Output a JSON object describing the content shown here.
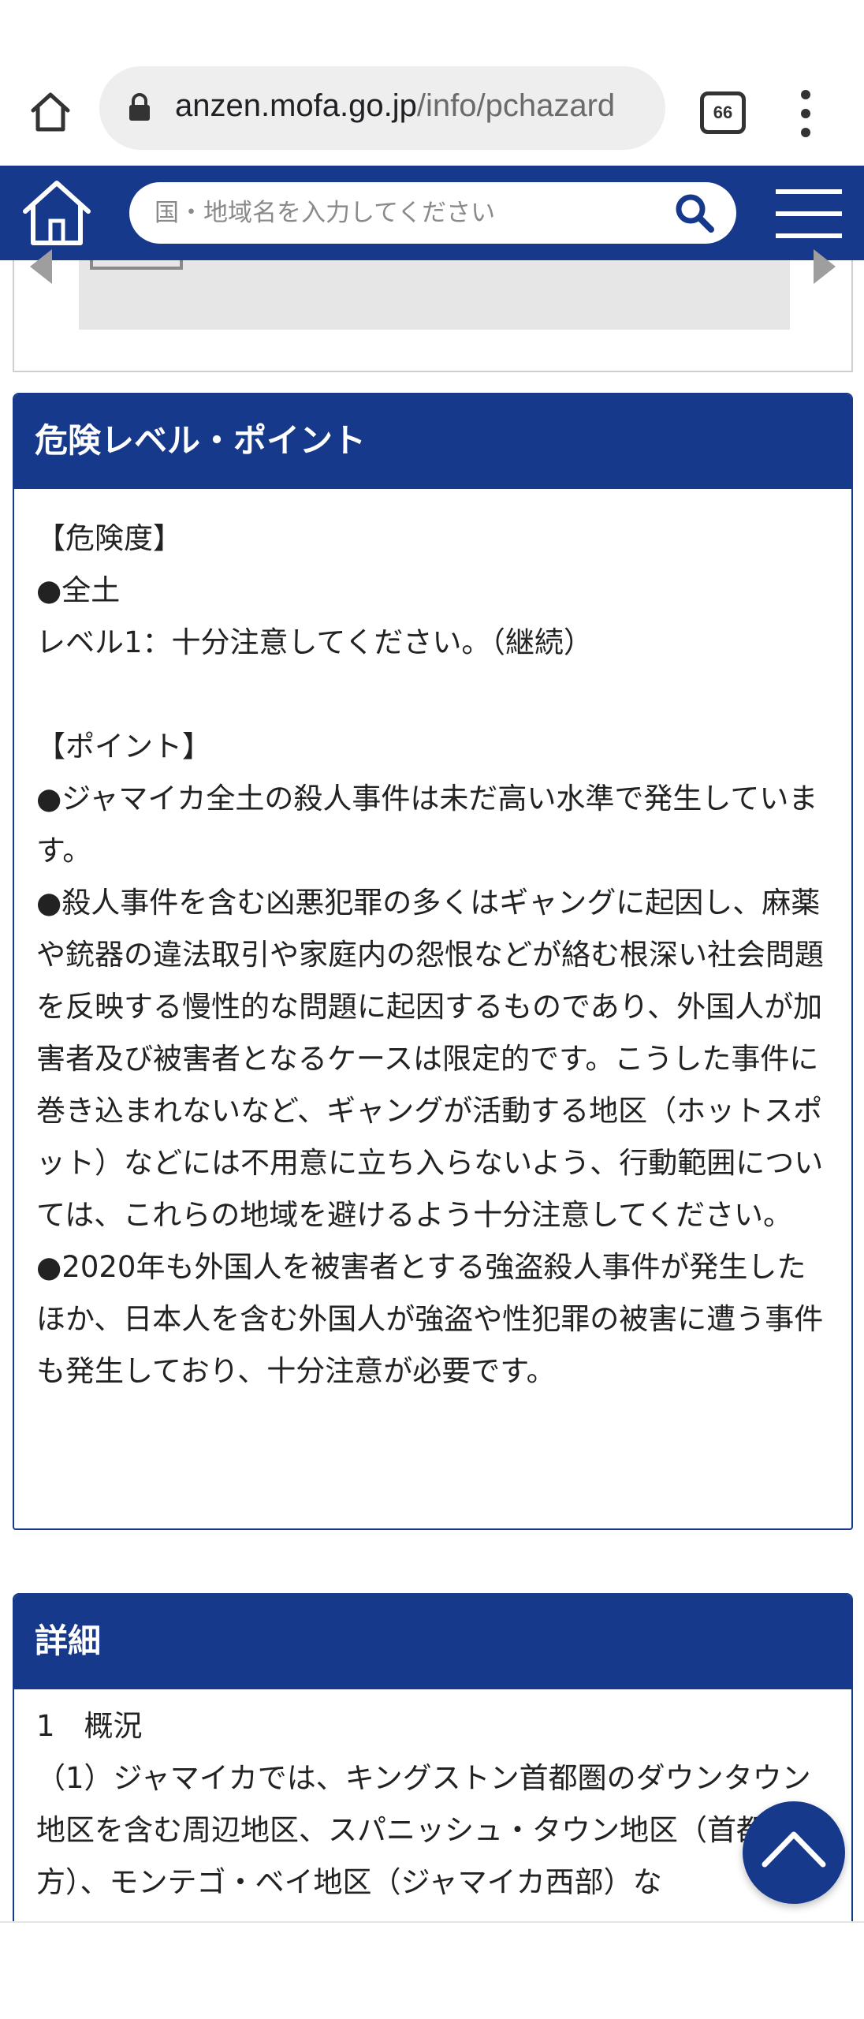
{
  "browser": {
    "url_host": "anzen.mofa.go.jp",
    "url_path": "/info/pchazard",
    "tab_count": "66"
  },
  "site": {
    "search_placeholder": "国・地域名を入力してください"
  },
  "risk_section": {
    "title": "危険レベル・ポイント",
    "paragraphs": [
      "【危険度】",
      "●全土",
      "レベル1：十分注意してください。（継続）",
      "",
      "【ポイント】",
      "●ジャマイカ全土の殺人事件は未だ高い水準で発生しています。",
      "●殺人事件を含む凶悪犯罪の多くはギャングに起因し、麻薬や銃器の違法取引や家庭内の怨恨などが絡む根深い社会問題を反映する慢性的な問題に起因するものであり、外国人が加害者及び被害者となるケースは限定的です。こうした事件に巻き込まれないなど、ギャングが活動する地区（ホットスポット）などには不用意に立ち入らないよう、行動範囲については、これらの地域を避けるよう十分注意してください。",
      "●2020年も外国人を被害者とする強盗殺人事件が発生したほか、日本人を含む外国人が強盗や性犯罪の被害に遭う事件も発生しており、十分注意が必要です。"
    ]
  },
  "detail_section": {
    "title": "詳細",
    "heading": "1　概況",
    "text": "（1）ジャマイカでは、キングストン首都圏のダウンタウン地区を含む周辺地区、スパニッシュ・タウン地区（首都圏西方）、モンテゴ・ベイ地区（ジャマイカ西部）な"
  }
}
